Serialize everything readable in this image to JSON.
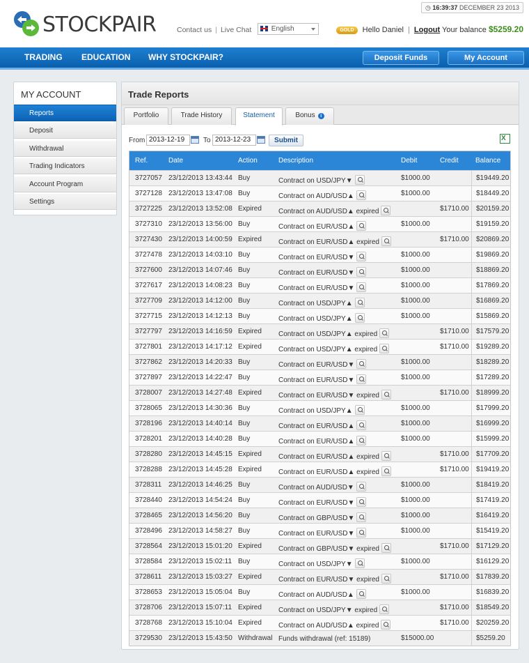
{
  "header": {
    "clock_time": "16:39:37",
    "clock_date": "DECEMBER 23 2013",
    "brand": "STOCKPAIR",
    "contact_us": "Contact us",
    "live_chat": "Live Chat",
    "separator": "|",
    "language": "English",
    "gold_badge": "GOLD",
    "greeting": "Hello Daniel",
    "logout": "Logout",
    "balance_label": "Your balance",
    "balance_value": "$5259.20"
  },
  "nav": {
    "trading": "TRADING",
    "education": "EDUCATION",
    "why": "WHY STOCKPAIR?",
    "deposit_funds": "Deposit Funds",
    "my_account": "My Account"
  },
  "sidebar": {
    "title": "MY ACCOUNT",
    "items": [
      {
        "label": "Reports"
      },
      {
        "label": "Deposit"
      },
      {
        "label": "Withdrawal"
      },
      {
        "label": "Trading Indicators"
      },
      {
        "label": "Account Program"
      },
      {
        "label": "Settings"
      }
    ]
  },
  "main": {
    "title": "Trade Reports",
    "tabs": [
      {
        "label": "Portfolio"
      },
      {
        "label": "Trade History"
      },
      {
        "label": "Statement"
      },
      {
        "label": "Bonus"
      }
    ],
    "filters": {
      "from_label": "From",
      "from_value": "2013-12-19",
      "to_label": "To",
      "to_value": "2013-12-23",
      "submit": "Submit"
    },
    "columns": {
      "ref": "Ref.",
      "date": "Date",
      "action": "Action",
      "description": "Description",
      "debit": "Debit",
      "credit": "Credit",
      "balance": "Balance"
    },
    "rows": [
      {
        "ref": "3727057",
        "date": "23/12/2013 13:43:44",
        "action": "Buy",
        "desc": "Contract on USD/JPY▼",
        "debit": "$1000.00",
        "credit": "",
        "balance": "$19449.20",
        "icon": true
      },
      {
        "ref": "3727128",
        "date": "23/12/2013 13:47:08",
        "action": "Buy",
        "desc": "Contract on AUD/USD▲",
        "debit": "$1000.00",
        "credit": "",
        "balance": "$18449.20",
        "icon": true
      },
      {
        "ref": "3727225",
        "date": "23/12/2013 13:52:08",
        "action": "Expired",
        "desc": "Contract on AUD/USD▲ expired",
        "debit": "",
        "credit": "$1710.00",
        "balance": "$20159.20",
        "icon": true
      },
      {
        "ref": "3727310",
        "date": "23/12/2013 13:56:00",
        "action": "Buy",
        "desc": "Contract on EUR/USD▲",
        "debit": "$1000.00",
        "credit": "",
        "balance": "$19159.20",
        "icon": true
      },
      {
        "ref": "3727430",
        "date": "23/12/2013 14:00:59",
        "action": "Expired",
        "desc": "Contract on EUR/USD▲ expired",
        "debit": "",
        "credit": "$1710.00",
        "balance": "$20869.20",
        "icon": true
      },
      {
        "ref": "3727478",
        "date": "23/12/2013 14:03:10",
        "action": "Buy",
        "desc": "Contract on EUR/USD▼",
        "debit": "$1000.00",
        "credit": "",
        "balance": "$19869.20",
        "icon": true
      },
      {
        "ref": "3727600",
        "date": "23/12/2013 14:07:46",
        "action": "Buy",
        "desc": "Contract on EUR/USD▼",
        "debit": "$1000.00",
        "credit": "",
        "balance": "$18869.20",
        "icon": true
      },
      {
        "ref": "3727617",
        "date": "23/12/2013 14:08:23",
        "action": "Buy",
        "desc": "Contract on EUR/USD▼",
        "debit": "$1000.00",
        "credit": "",
        "balance": "$17869.20",
        "icon": true
      },
      {
        "ref": "3727709",
        "date": "23/12/2013 14:12:00",
        "action": "Buy",
        "desc": "Contract on USD/JPY▲",
        "debit": "$1000.00",
        "credit": "",
        "balance": "$16869.20",
        "icon": true
      },
      {
        "ref": "3727715",
        "date": "23/12/2013 14:12:13",
        "action": "Buy",
        "desc": "Contract on USD/JPY▲",
        "debit": "$1000.00",
        "credit": "",
        "balance": "$15869.20",
        "icon": true
      },
      {
        "ref": "3727797",
        "date": "23/12/2013 14:16:59",
        "action": "Expired",
        "desc": "Contract on USD/JPY▲ expired",
        "debit": "",
        "credit": "$1710.00",
        "balance": "$17579.20",
        "icon": true
      },
      {
        "ref": "3727801",
        "date": "23/12/2013 14:17:12",
        "action": "Expired",
        "desc": "Contract on USD/JPY▲ expired",
        "debit": "",
        "credit": "$1710.00",
        "balance": "$19289.20",
        "icon": true
      },
      {
        "ref": "3727862",
        "date": "23/12/2013 14:20:33",
        "action": "Buy",
        "desc": "Contract on EUR/USD▼",
        "debit": "$1000.00",
        "credit": "",
        "balance": "$18289.20",
        "icon": true
      },
      {
        "ref": "3727897",
        "date": "23/12/2013 14:22:47",
        "action": "Buy",
        "desc": "Contract on EUR/USD▼",
        "debit": "$1000.00",
        "credit": "",
        "balance": "$17289.20",
        "icon": true
      },
      {
        "ref": "3728007",
        "date": "23/12/2013 14:27:48",
        "action": "Expired",
        "desc": "Contract on EUR/USD▼ expired",
        "debit": "",
        "credit": "$1710.00",
        "balance": "$18999.20",
        "icon": true
      },
      {
        "ref": "3728065",
        "date": "23/12/2013 14:30:36",
        "action": "Buy",
        "desc": "Contract on USD/JPY▲",
        "debit": "$1000.00",
        "credit": "",
        "balance": "$17999.20",
        "icon": true
      },
      {
        "ref": "3728196",
        "date": "23/12/2013 14:40:14",
        "action": "Buy",
        "desc": "Contract on EUR/USD▲",
        "debit": "$1000.00",
        "credit": "",
        "balance": "$16999.20",
        "icon": true
      },
      {
        "ref": "3728201",
        "date": "23/12/2013 14:40:28",
        "action": "Buy",
        "desc": "Contract on EUR/USD▲",
        "debit": "$1000.00",
        "credit": "",
        "balance": "$15999.20",
        "icon": true
      },
      {
        "ref": "3728280",
        "date": "23/12/2013 14:45:15",
        "action": "Expired",
        "desc": "Contract on EUR/USD▲ expired",
        "debit": "",
        "credit": "$1710.00",
        "balance": "$17709.20",
        "icon": true
      },
      {
        "ref": "3728288",
        "date": "23/12/2013 14:45:28",
        "action": "Expired",
        "desc": "Contract on EUR/USD▲ expired",
        "debit": "",
        "credit": "$1710.00",
        "balance": "$19419.20",
        "icon": true
      },
      {
        "ref": "3728311",
        "date": "23/12/2013 14:46:25",
        "action": "Buy",
        "desc": "Contract on AUD/USD▼",
        "debit": "$1000.00",
        "credit": "",
        "balance": "$18419.20",
        "icon": true
      },
      {
        "ref": "3728440",
        "date": "23/12/2013 14:54:24",
        "action": "Buy",
        "desc": "Contract on EUR/USD▼",
        "debit": "$1000.00",
        "credit": "",
        "balance": "$17419.20",
        "icon": true
      },
      {
        "ref": "3728465",
        "date": "23/12/2013 14:56:20",
        "action": "Buy",
        "desc": "Contract on GBP/USD▼",
        "debit": "$1000.00",
        "credit": "",
        "balance": "$16419.20",
        "icon": true
      },
      {
        "ref": "3728496",
        "date": "23/12/2013 14:58:27",
        "action": "Buy",
        "desc": "Contract on EUR/USD▼",
        "debit": "$1000.00",
        "credit": "",
        "balance": "$15419.20",
        "icon": true
      },
      {
        "ref": "3728564",
        "date": "23/12/2013 15:01:20",
        "action": "Expired",
        "desc": "Contract on GBP/USD▼ expired",
        "debit": "",
        "credit": "$1710.00",
        "balance": "$17129.20",
        "icon": true
      },
      {
        "ref": "3728584",
        "date": "23/12/2013 15:02:11",
        "action": "Buy",
        "desc": "Contract on USD/JPY▼",
        "debit": "$1000.00",
        "credit": "",
        "balance": "$16129.20",
        "icon": true
      },
      {
        "ref": "3728611",
        "date": "23/12/2013 15:03:27",
        "action": "Expired",
        "desc": "Contract on EUR/USD▼ expired",
        "debit": "",
        "credit": "$1710.00",
        "balance": "$17839.20",
        "icon": true
      },
      {
        "ref": "3728653",
        "date": "23/12/2013 15:05:04",
        "action": "Buy",
        "desc": "Contract on AUD/USD▲",
        "debit": "$1000.00",
        "credit": "",
        "balance": "$16839.20",
        "icon": true
      },
      {
        "ref": "3728706",
        "date": "23/12/2013 15:07:11",
        "action": "Expired",
        "desc": "Contract on USD/JPY▼ expired",
        "debit": "",
        "credit": "$1710.00",
        "balance": "$18549.20",
        "icon": true
      },
      {
        "ref": "3728768",
        "date": "23/12/2013 15:10:04",
        "action": "Expired",
        "desc": "Contract on AUD/USD▲ expired",
        "debit": "",
        "credit": "$1710.00",
        "balance": "$20259.20",
        "icon": true
      },
      {
        "ref": "3729530",
        "date": "23/12/2013 15:43:50",
        "action": "Withdrawal",
        "desc": "Funds withdrawal (ref: 15189)",
        "debit": "$15000.00",
        "credit": "",
        "balance": "$5259.20",
        "icon": false
      }
    ]
  },
  "colors": {
    "accent": "#0a5fae",
    "header_blue": "#2c86d8",
    "balance_green": "#3b8e1a"
  },
  "icons": {
    "clock": "clock-icon",
    "calendar": "calendar-icon",
    "search": "magnifier-icon",
    "export": "excel-export-icon",
    "info": "info-icon"
  }
}
